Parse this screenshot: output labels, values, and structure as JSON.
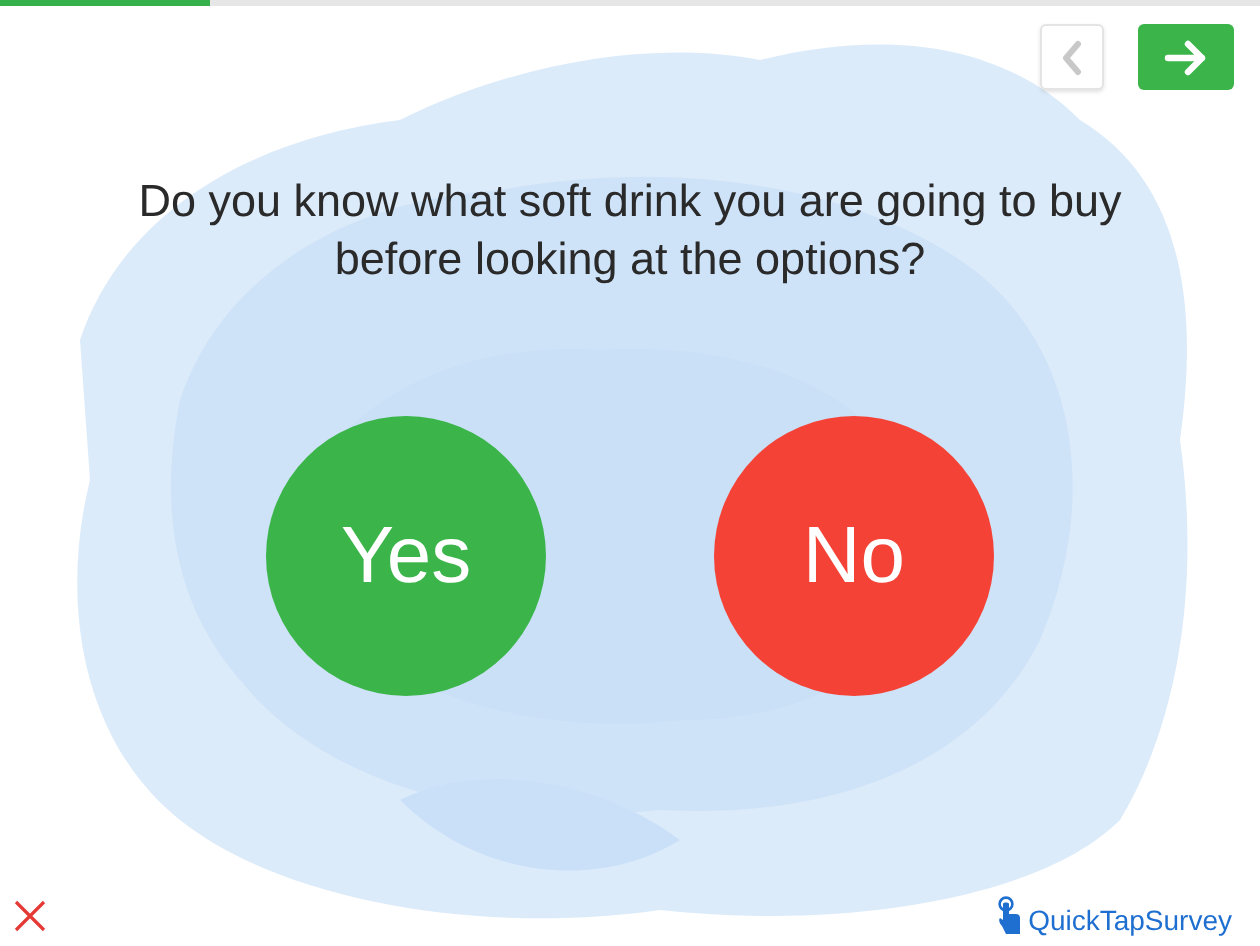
{
  "progress": {
    "level": 0.167
  },
  "nav": {
    "back": {
      "disabled": true
    },
    "next": {
      "disabled": false
    }
  },
  "question": "Do you know what soft drink you are going to buy before looking at the options?",
  "answers": [
    {
      "label": "Yes",
      "color": "#3bb54a"
    },
    {
      "label": "No",
      "color": "#f44336"
    }
  ],
  "brand": "QuickTapSurvey"
}
